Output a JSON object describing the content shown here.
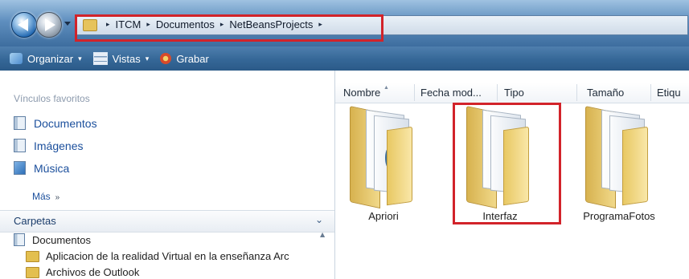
{
  "address_bar": {
    "breadcrumbs": [
      "ITCM",
      "Documentos",
      "NetBeansProjects"
    ],
    "separator": "▸"
  },
  "toolbar": {
    "items": [
      {
        "label": "Organizar",
        "icon": "organize-icon",
        "has_dropdown": true
      },
      {
        "label": "Vistas",
        "icon": "views-icon",
        "has_dropdown": true
      },
      {
        "label": "Grabar",
        "icon": "burn-icon",
        "has_dropdown": false
      }
    ]
  },
  "left_pane": {
    "favorites_title": "Vínculos favoritos",
    "favorites": [
      {
        "label": "Documentos",
        "icon": "documents-icon"
      },
      {
        "label": "Imágenes",
        "icon": "pictures-icon"
      },
      {
        "label": "Música",
        "icon": "music-icon"
      }
    ],
    "more_label": "Más",
    "more_arrows": "»",
    "folders_title": "Carpetas",
    "folders_chevron": "⌄",
    "tree": [
      {
        "label": "Documentos",
        "icon": "documents-icon"
      },
      {
        "label": "Aplicacion de la realidad Virtual en la enseñanza Arc",
        "icon": "folder-icon"
      },
      {
        "label": "Archivos de Outlook",
        "icon": "folder-icon"
      }
    ]
  },
  "file_list": {
    "columns": [
      "Nombre",
      "Fecha mod...",
      "Tipo",
      "Tamaño",
      "Etiqu"
    ],
    "items": [
      {
        "label": "Apriori",
        "icon": "folder-icon"
      },
      {
        "label": "Interfaz",
        "icon": "folder-icon"
      },
      {
        "label": "ProgramaFotos",
        "icon": "folder-icon"
      }
    ]
  },
  "colors": {
    "highlight": "#d2232a",
    "link": "#1b4f9c",
    "toolbar": "#356797"
  }
}
